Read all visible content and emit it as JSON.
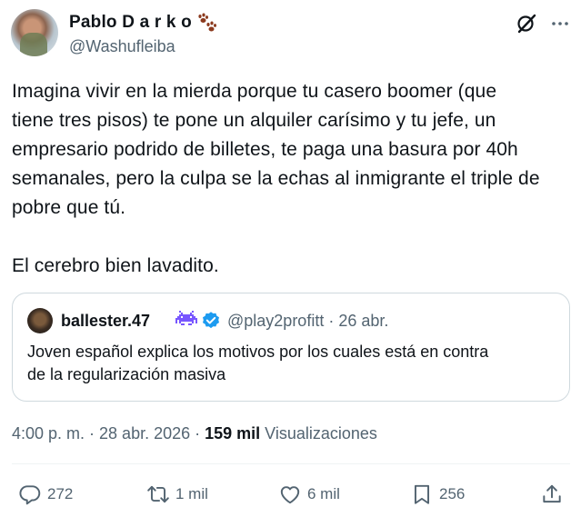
{
  "author": {
    "name": "Pablo D a r k o",
    "handle": "@Washufleiba"
  },
  "tweet": {
    "paragraph1_lines": [
      "Imagina vivir en la mierda porque tu casero boomer (que",
      "tiene tres pisos) te pone un alquiler carísimo y tu jefe, un",
      "empresario podrido de billetes, te paga una basura por 40h",
      "semanales, pero la culpa se la echas al inmigrante el triple de",
      "pobre que tú."
    ],
    "paragraph2": "El cerebro bien lavadito."
  },
  "quote": {
    "name": "ballester.47",
    "handle_date": "@play2profitt · 26 abr.",
    "text_lines": [
      "Joven español explica los motivos por los cuales está en contra",
      "de la regularización masiva"
    ]
  },
  "meta": {
    "timestamp": "4:00 p. m. · 28 abr. 2026 · ",
    "views_count": "159 mil",
    "views_label": " Visualizaciones"
  },
  "actions": {
    "reply": "272",
    "retweet": "1 mil",
    "like": "6 mil",
    "bookmark": "256"
  },
  "icons": {
    "paw": "paw-prints-icon",
    "grok": "grok-icon",
    "more": "more-icon",
    "alien": "space-invader-icon",
    "verified": "verified-badge-icon",
    "reply": "reply-icon",
    "retweet": "retweet-icon",
    "like": "heart-icon",
    "bookmark": "bookmark-icon",
    "share": "share-icon"
  },
  "colors": {
    "text": "#0f1419",
    "secondary": "#536471",
    "border": "#cfd9de",
    "verified": "#1d9bf0",
    "alien": "#7856ff",
    "paw": "#8b3a1e"
  }
}
